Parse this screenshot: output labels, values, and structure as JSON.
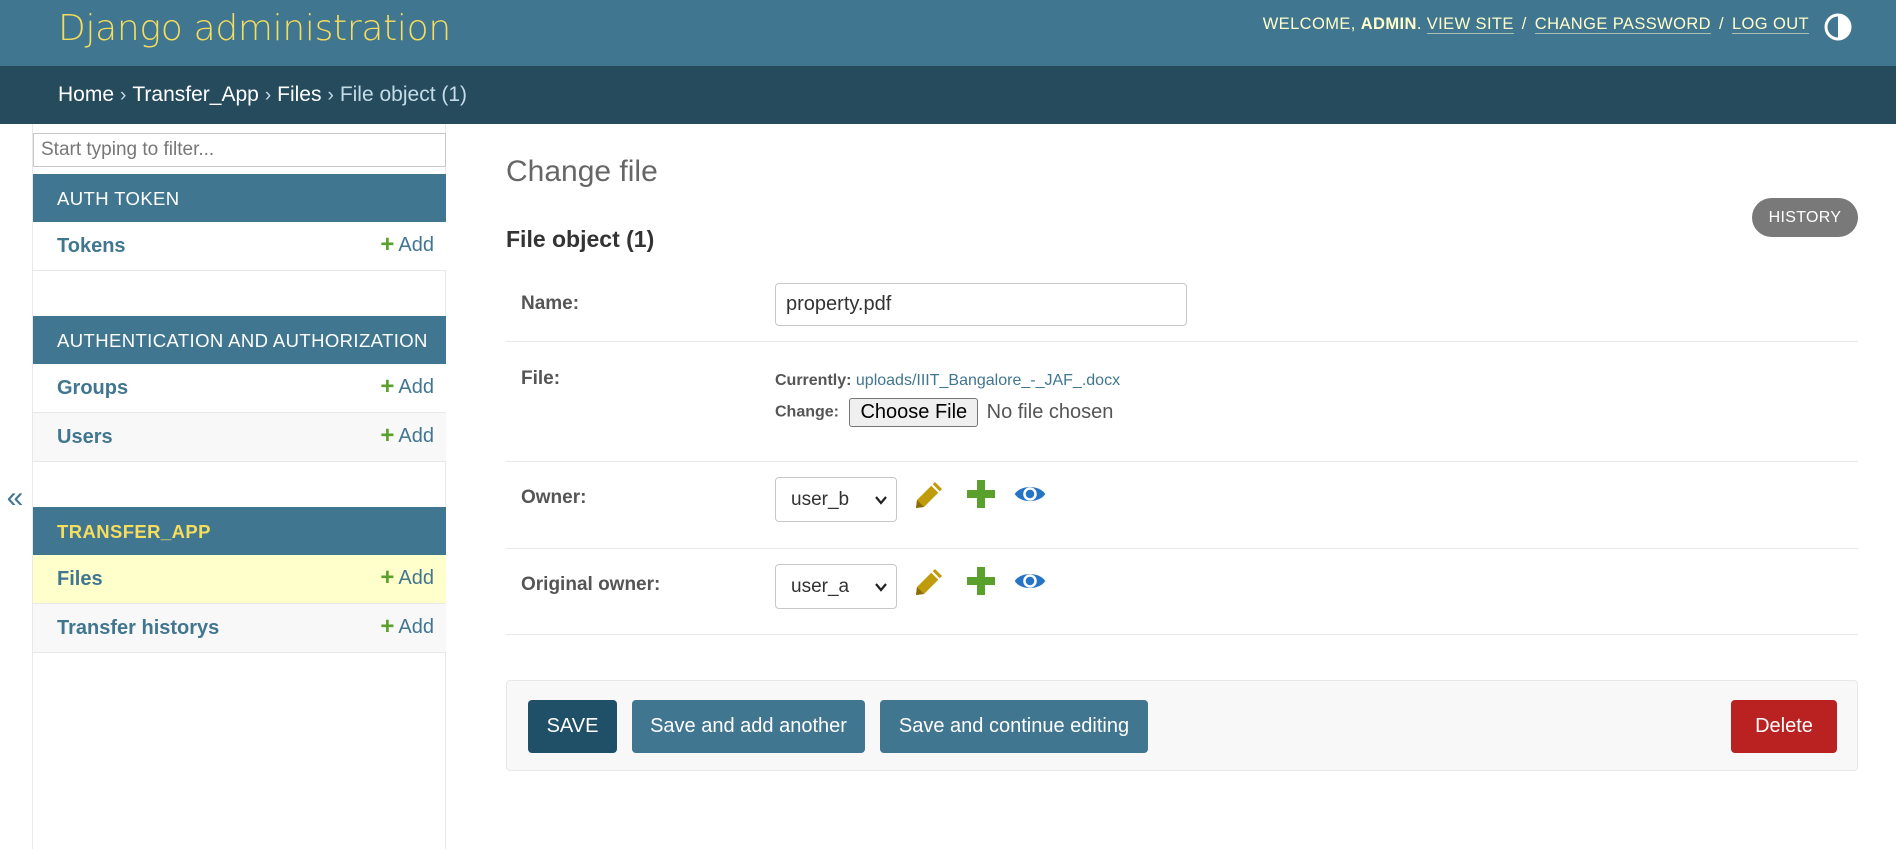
{
  "header": {
    "branding": "Django administration",
    "welcome": "WELCOME,",
    "username": "ADMIN",
    "view_site": "VIEW SITE",
    "change_password": "CHANGE PASSWORD",
    "log_out": "LOG OUT",
    "separator": "/",
    "theme_icon": "theme-toggle-icon"
  },
  "breadcrumbs": {
    "home": "Home",
    "app": "Transfer_App",
    "model": "Files",
    "current": "File object (1)",
    "separator": "›"
  },
  "sidebar": {
    "filter_placeholder": "Start typing to filter...",
    "toggle_label": "«",
    "modules": [
      {
        "caption": "AUTH TOKEN",
        "models": [
          {
            "name": "Tokens",
            "add": "Add"
          }
        ]
      },
      {
        "caption": "AUTHENTICATION AND AUTHORIZATION",
        "models": [
          {
            "name": "Groups",
            "add": "Add"
          },
          {
            "name": "Users",
            "add": "Add"
          }
        ]
      },
      {
        "caption": "TRANSFER_APP",
        "models": [
          {
            "name": "Files",
            "add": "Add"
          },
          {
            "name": "Transfer historys",
            "add": "Add"
          }
        ]
      }
    ]
  },
  "content": {
    "title": "Change file",
    "subtitle": "File object (1)",
    "history_button": "HISTORY"
  },
  "form": {
    "name": {
      "label": "Name:",
      "value": "property.pdf"
    },
    "file": {
      "label": "File:",
      "currently_label": "Currently:",
      "currently_value": "uploads/IIIT_Bangalore_-_JAF_.docx",
      "change_label": "Change:",
      "choose_button": "Choose File",
      "no_file": "No file chosen"
    },
    "owner": {
      "label": "Owner:",
      "selected": "user_b"
    },
    "original_owner": {
      "label": "Original owner:",
      "selected": "user_a"
    }
  },
  "submit_row": {
    "save": "SAVE",
    "save_add_another": "Save and add another",
    "save_continue": "Save and continue editing",
    "delete": "Delete"
  },
  "colors": {
    "header_bg": "#417690",
    "breadcrumbs_bg": "#264b5d",
    "branding": "#f5dd5d",
    "save_bg": "#205067",
    "delete_bg": "#ba2121",
    "add_plus": "#5aa02c",
    "edit_icon": "#c09b0b",
    "view_icon": "#2574c6",
    "current_row_bg": "#ffffcc"
  }
}
